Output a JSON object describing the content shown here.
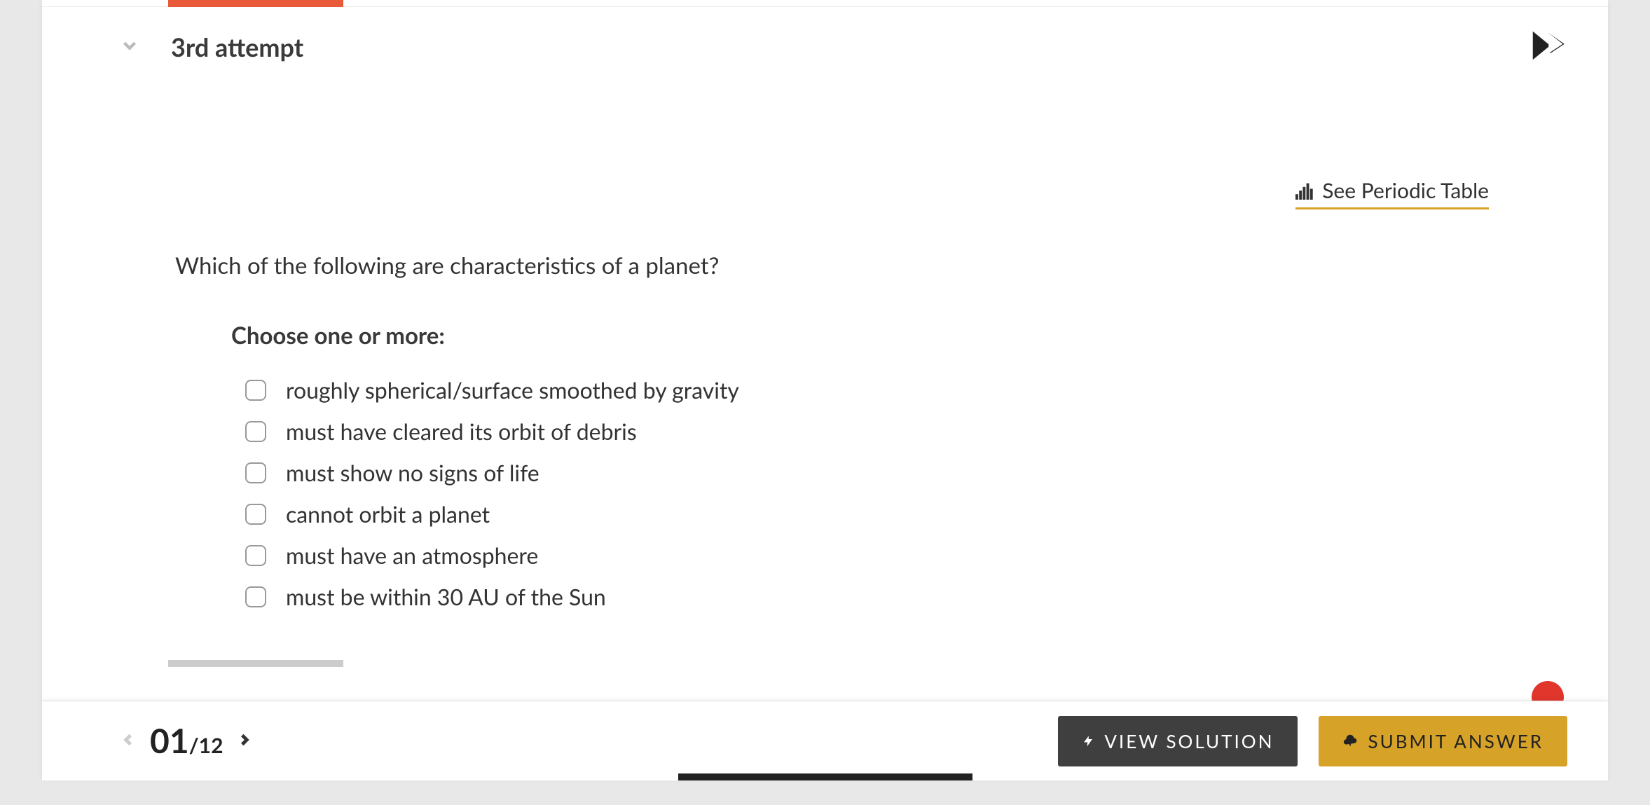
{
  "attempt": {
    "title": "3rd attempt"
  },
  "periodic": {
    "label": "See Periodic Table"
  },
  "question": {
    "prompt": "Which of the following are characteristics of a planet?",
    "instruction": "Choose one or more:",
    "options": [
      "roughly spherical/surface smoothed by gravity",
      "must have cleared its orbit of debris",
      "must show no signs of life",
      "cannot orbit a planet",
      "must have an atmosphere",
      "must be within 30 AU of the Sun"
    ]
  },
  "nav": {
    "current": "01",
    "separator": "/",
    "total": "12"
  },
  "buttons": {
    "view_solution": "VIEW SOLUTION",
    "submit": "SUBMIT ANSWER"
  }
}
